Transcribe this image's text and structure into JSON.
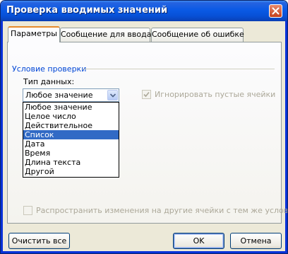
{
  "window": {
    "title": "Проверка вводимых значений"
  },
  "tabs": [
    {
      "label": "Параметры",
      "active": true
    },
    {
      "label": "Сообщение для ввода",
      "active": false
    },
    {
      "label": "Сообщение об ошибке",
      "active": false
    }
  ],
  "group": {
    "title": "Условие проверки"
  },
  "data_type": {
    "label": "Тип данных:",
    "selected": "Любое значение",
    "options": [
      "Любое значение",
      "Целое число",
      "Действительное",
      "Список",
      "Дата",
      "Время",
      "Длина текста",
      "Другой"
    ],
    "highlighted": "Список"
  },
  "ignore_blank": {
    "label": "Игнорировать пустые ячейки",
    "checked": true,
    "enabled": false
  },
  "apply_all": {
    "label": "Распространить изменения на другие ячейки с тем же условием",
    "checked": false,
    "enabled": false
  },
  "buttons": {
    "clear_all": "Очистить все",
    "ok": "OK",
    "cancel": "Отмена"
  },
  "colors": {
    "title_bar": "#0a5ae5",
    "selection": "#316ac5",
    "group_title": "#0046d5",
    "disabled_text": "#aca899"
  }
}
